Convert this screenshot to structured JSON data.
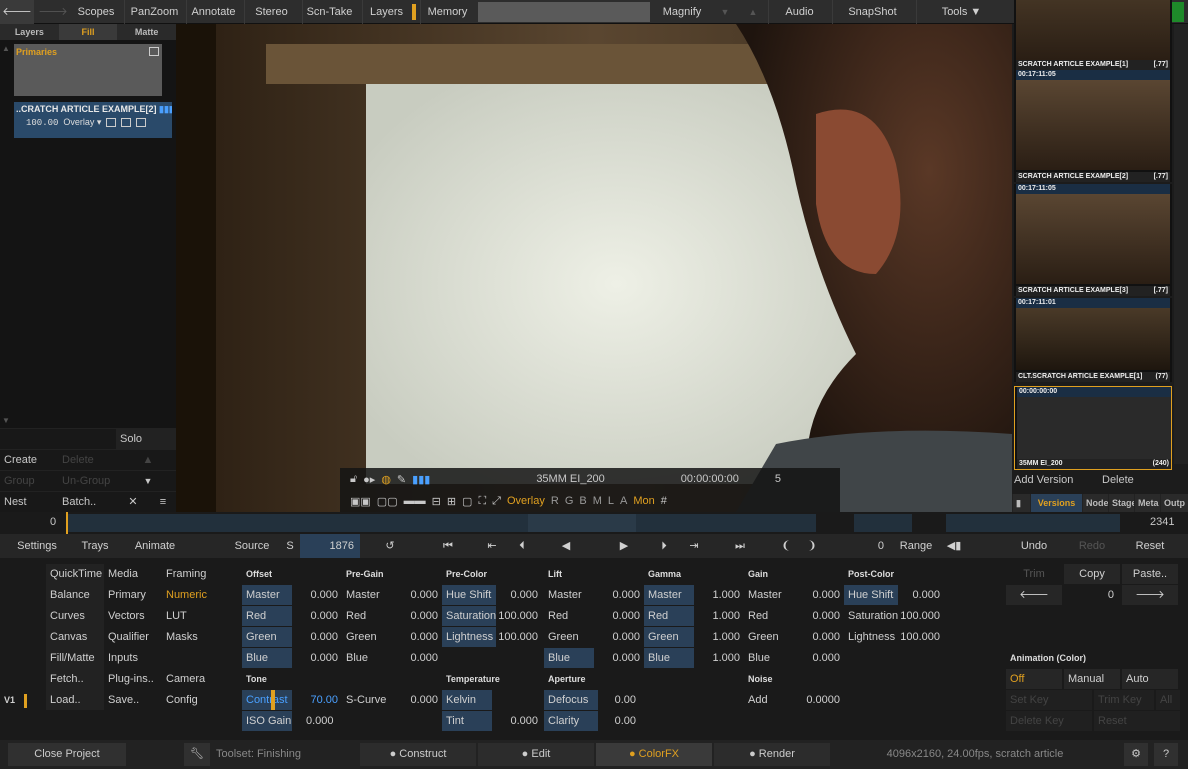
{
  "topbar": {
    "items": [
      "Scopes",
      "PanZoom",
      "Annotate",
      "Stereo",
      "Scn-Take",
      "Layers",
      "Memory",
      "Magnify",
      "Audio",
      "SnapShot",
      "Tools ▼"
    ],
    "back": "🡐",
    "fwd": "🡒",
    "up": "▲",
    "down": "▼",
    "green": "–"
  },
  "left": {
    "tabs": [
      "Layers",
      "Fill",
      "Matte"
    ],
    "primaries": "Primaries",
    "layer_name": "..CRATCH ARTICLE EXAMPLE[2]",
    "opacity": "100.00",
    "blend": "Overlay ▾",
    "solo": "Solo",
    "create": "Create",
    "delete": "Delete",
    "group": "Group",
    "ungroup": "Un-Group",
    "nest": "Nest",
    "batch": "Batch..",
    "x": "✕",
    "menu": "≡",
    "up_arrow": "▲",
    "down_arrow": "▼"
  },
  "viewer": {
    "format": "35MM EI_200",
    "timecode": "00:00:00:00",
    "frame": "5",
    "overlay": "Overlay",
    "channels": [
      "R",
      "G",
      "B",
      "M",
      "L",
      "A"
    ],
    "mon": "Mon",
    "hash": "#"
  },
  "right": {
    "thumbs": [
      {
        "tc": "",
        "cap": "SCRATCH ARTICLE EXAMPLE[1]",
        "num": "[.77]"
      },
      {
        "tc": "00:17:11:05",
        "cap": "SCRATCH ARTICLE EXAMPLE[2]",
        "num": "[.77]"
      },
      {
        "tc": "00:17:11:05",
        "cap": "SCRATCH ARTICLE EXAMPLE[3]",
        "num": "[.77]"
      },
      {
        "tc": "00:17:11:01",
        "cap": "CLT.SCRATCH ARTICLE EXAMPLE[1]",
        "num": "(77)"
      },
      {
        "tc": "00:00:00:00",
        "cap": "35MM EI_200",
        "num": "(240)"
      }
    ],
    "add_version": "Add Version",
    "delete": "Delete",
    "tabs": [
      "Versions",
      "Node",
      "Stage",
      "Meta",
      "Outp"
    ]
  },
  "timeline": {
    "start": "0",
    "end": "2341"
  },
  "transport": {
    "settings": "Settings",
    "trays": "Trays",
    "animate": "Animate",
    "source": "Source",
    "s": "S",
    "frame": "1876",
    "count": "0",
    "range": "Range",
    "undo": "Undo",
    "redo": "Redo",
    "reset": "Reset"
  },
  "menu": {
    "col1": [
      "QuickTime",
      "Balance",
      "Curves",
      "Canvas",
      "Fill/Matte",
      "Fetch..",
      "Load.."
    ],
    "col2": [
      "Media",
      "Primary",
      "Vectors",
      "Qualifier",
      "Inputs",
      "Plug-ins..",
      "Save.."
    ],
    "col3": [
      "Framing",
      "Numeric",
      "LUT",
      "Masks",
      "",
      "Camera",
      "Config"
    ],
    "v1": "V1"
  },
  "params": {
    "offset": {
      "h": "Offset",
      "rows": [
        [
          "Master",
          "0.000"
        ],
        [
          "Red",
          "0.000"
        ],
        [
          "Green",
          "0.000"
        ],
        [
          "Blue",
          "0.000"
        ]
      ]
    },
    "pregain": {
      "h": "Pre-Gain",
      "rows": [
        [
          "Master",
          "0.000"
        ],
        [
          "Red",
          "0.000"
        ],
        [
          "Green",
          "0.000"
        ],
        [
          "Blue",
          "0.000"
        ]
      ]
    },
    "precolor": {
      "h": "Pre-Color",
      "rows": [
        [
          "Hue Shift",
          "0.000"
        ],
        [
          "Saturation",
          "100.000"
        ],
        [
          "Lightness",
          "100.000"
        ]
      ]
    },
    "lift": {
      "h": "Lift",
      "rows": [
        [
          "Master",
          "0.000"
        ],
        [
          "Red",
          "0.000"
        ],
        [
          "Green",
          "0.000"
        ],
        [
          "Blue",
          "0.000"
        ]
      ]
    },
    "gamma": {
      "h": "Gamma",
      "rows": [
        [
          "Master",
          "1.000"
        ],
        [
          "Red",
          "1.000"
        ],
        [
          "Green",
          "1.000"
        ],
        [
          "Blue",
          "1.000"
        ]
      ]
    },
    "gain": {
      "h": "Gain",
      "rows": [
        [
          "Master",
          "0.000"
        ],
        [
          "Red",
          "0.000"
        ],
        [
          "Green",
          "0.000"
        ],
        [
          "Blue",
          "0.000"
        ]
      ]
    },
    "postcolor": {
      "h": "Post-Color",
      "rows": [
        [
          "Hue Shift",
          "0.000"
        ],
        [
          "Saturation",
          "100.000"
        ],
        [
          "Lightness",
          "100.000"
        ]
      ]
    },
    "tone": {
      "h": "Tone",
      "contrast": "Contrast",
      "contrast_v": "70.00",
      "scurve": "S-Curve",
      "scurve_v": "0.000",
      "iso": "ISO Gain",
      "iso_v": "0.000"
    },
    "temp": {
      "h": "Temperature",
      "kelvin": "Kelvin",
      "tint": "Tint",
      "tint_v": "0.000"
    },
    "aperture": {
      "h": "Aperture",
      "defocus": "Defocus",
      "defocus_v": "0.00",
      "clarity": "Clarity",
      "clarity_v": "0.00"
    },
    "noise": {
      "h": "Noise",
      "add": "Add",
      "add_v": "0.0000"
    }
  },
  "anim": {
    "trim": "Trim",
    "copy": "Copy",
    "paste": "Paste..",
    "count": "0",
    "title": "Animation (Color)",
    "off": "Off",
    "manual": "Manual",
    "auto": "Auto",
    "setkey": "Set Key",
    "trimkey": "Trim Key",
    "all": "All",
    "deletekey": "Delete Key",
    "reset": "Reset"
  },
  "bottom": {
    "close": "Close Project",
    "toolset": "Toolset: Finishing",
    "construct": "● Construct",
    "edit": "● Edit",
    "colorfx": "● ColorFX",
    "render": "● Render",
    "info": "4096x2160, 24.00fps, scratch article",
    "gear": "⚙",
    "help": "?"
  },
  "colors": {
    "accent": "#e0a020",
    "panel": "#2a4058",
    "green": "#1e8a2a"
  }
}
